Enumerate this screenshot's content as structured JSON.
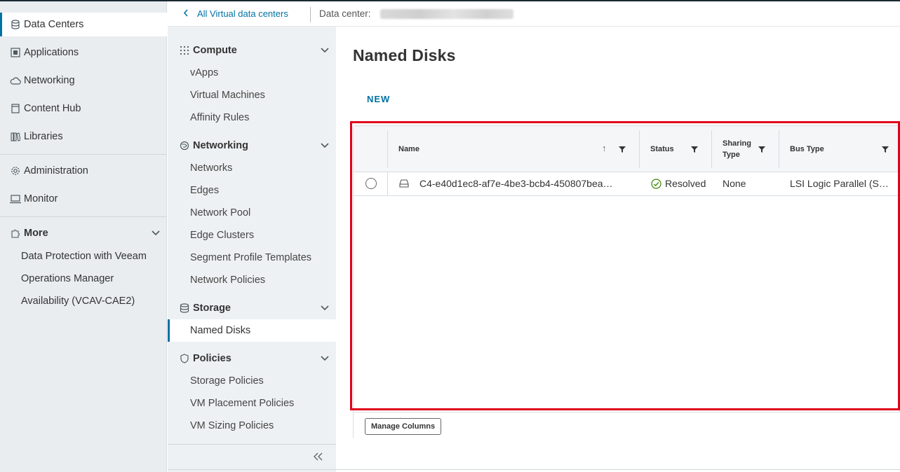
{
  "left_nav": {
    "items": [
      {
        "label": "Data Centers",
        "icon": "datacenter-icon"
      },
      {
        "label": "Applications",
        "icon": "applications-icon"
      },
      {
        "label": "Networking",
        "icon": "cloud-icon"
      },
      {
        "label": "Content Hub",
        "icon": "content-hub-icon"
      },
      {
        "label": "Libraries",
        "icon": "library-icon"
      }
    ],
    "items2": [
      {
        "label": "Administration",
        "icon": "gear-icon"
      },
      {
        "label": "Monitor",
        "icon": "monitor-icon"
      }
    ],
    "more": {
      "label": "More",
      "icon": "puzzle-icon"
    },
    "more_items": [
      "Data Protection with Veeam",
      "Operations Manager",
      "Availability (VCAV-CAE2)"
    ]
  },
  "breadcrumb": {
    "back_label": "All Virtual data centers",
    "dc_label": "Data center:"
  },
  "second_nav": {
    "groups": [
      {
        "label": "Compute",
        "icon": "compute-icon",
        "items": [
          "vApps",
          "Virtual Machines",
          "Affinity Rules"
        ]
      },
      {
        "label": "Networking",
        "icon": "networking-icon",
        "items": [
          "Networks",
          "Edges",
          "Network Pool",
          "Edge Clusters",
          "Segment Profile Templates",
          "Network Policies"
        ]
      },
      {
        "label": "Storage",
        "icon": "storage-icon",
        "items": [
          "Named Disks"
        ]
      },
      {
        "label": "Policies",
        "icon": "shield-icon",
        "items": [
          "Storage Policies",
          "VM Placement Policies",
          "VM Sizing Policies"
        ]
      }
    ],
    "active_item": "Named Disks"
  },
  "main": {
    "title": "Named Disks",
    "new_label": "NEW",
    "grid": {
      "columns": [
        "Name",
        "Status",
        "Sharing Type",
        "Bus Type"
      ],
      "rows": [
        {
          "name": "C4-e40d1ec8-af7e-4be3-bcb4-450807bea…",
          "status": "Resolved",
          "sharing": "None",
          "bus": "LSI Logic Parallel (S…"
        }
      ],
      "manage_columns_label": "Manage Columns"
    }
  },
  "colors": {
    "accent": "#0072a3",
    "highlight": "#e0001b",
    "success": "#3c8500"
  }
}
